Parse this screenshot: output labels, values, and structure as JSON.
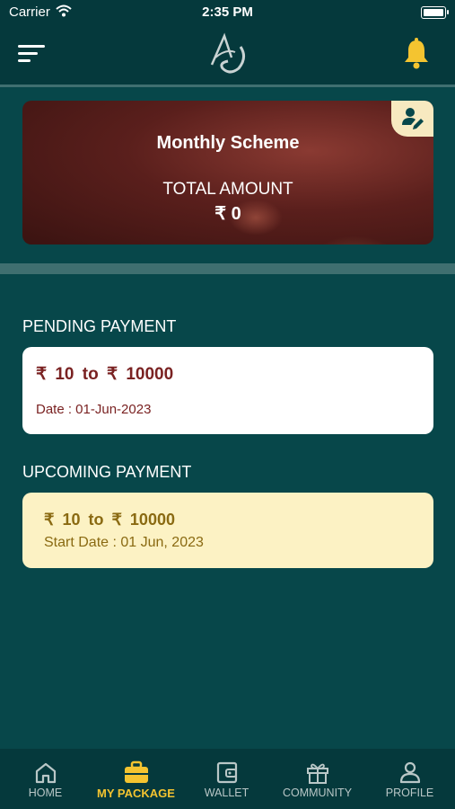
{
  "status_bar": {
    "carrier": "Carrier",
    "time": "2:35 PM"
  },
  "header": {
    "logo_icon": "ag-monogram-logo-icon",
    "menu_icon": "menu-icon",
    "bell_icon": "bell-icon"
  },
  "scheme_card": {
    "title": "Monthly Scheme",
    "total_label": "TOTAL AMOUNT",
    "total_value": "₹ 0",
    "edit_icon": "user-edit-icon"
  },
  "pending": {
    "section_title": "PENDING PAYMENT",
    "amount": "₹ 10  to ₹ 10000",
    "date": "Date : 01-Jun-2023"
  },
  "upcoming": {
    "section_title": "UPCOMING PAYMENT",
    "amount": "₹ 10  to ₹ 10000",
    "date": "Start Date : 01  Jun, 2023"
  },
  "nav": [
    {
      "label": "HOME",
      "icon": "home-icon",
      "active": false
    },
    {
      "label": "MY PACKAGE",
      "icon": "briefcase-icon",
      "active": true
    },
    {
      "label": "WALLET",
      "icon": "wallet-icon",
      "active": false
    },
    {
      "label": "COMMUNITY",
      "icon": "gift-icon",
      "active": false
    },
    {
      "label": "PROFILE",
      "icon": "person-icon",
      "active": false
    }
  ],
  "colors": {
    "background": "#07474a",
    "header": "#05393c",
    "accent": "#f4c430",
    "pending_text": "#7a2222",
    "upcoming_bg": "#fcf2c4",
    "upcoming_text": "#8a6a12"
  }
}
